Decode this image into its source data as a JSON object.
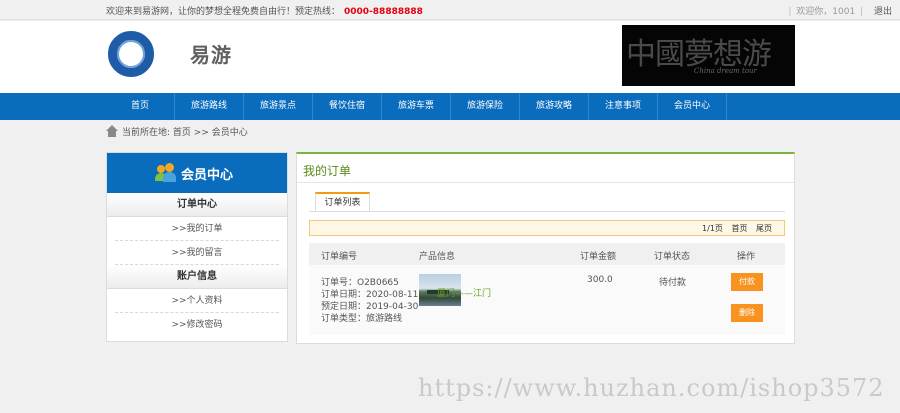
{
  "topbar": {
    "welcome": "欢迎来到易游网，让你的梦想全程免费自由行！预定热线：",
    "hotline": "0000-88888888",
    "user": "欢迎你，1001",
    "logout": "退出"
  },
  "header": {
    "logo_text": "易游",
    "brand_cn": "中國夢想游",
    "brand_en": "China dream tour"
  },
  "nav": {
    "items": [
      "首页",
      "旅游路线",
      "旅游景点",
      "餐饮住宿",
      "旅游车票",
      "旅游保险",
      "旅游攻略",
      "注意事项",
      "会员中心"
    ]
  },
  "breadcrumb": {
    "label": "当前所在地:",
    "path": "首页 >> 会员中心"
  },
  "sidebar": {
    "title": "会员中心",
    "group1": "订单中心",
    "item1": ">>我的订单",
    "item2": ">>我的留言",
    "group2": "账户信息",
    "item3": ">>个人资料",
    "item4": ">>修改密码"
  },
  "content": {
    "title": "我的订单",
    "tab": "订单列表",
    "pager": {
      "page": "1/1页",
      "first": "首页",
      "last": "尾页"
    },
    "columns": [
      "订单编号",
      "产品信息",
      "订单金额",
      "订单状态",
      "操作"
    ],
    "order": {
      "no": "订单号：O2B0665",
      "date": "订单日期：2020-08-11",
      "book_date": "预定日期：2019-04-30",
      "type": "订单类型：旅游路线",
      "product": "厦门——江门",
      "amount": "300.0",
      "status": "待付款",
      "pay": "付款",
      "delete": "删除"
    }
  },
  "watermark": "https://www.huzhan.com/ishop3572",
  "colors": {
    "primary": "#0a6cbd",
    "accent": "#f7931e",
    "hotline": "#e60012",
    "title_green": "#5a8a1c"
  }
}
